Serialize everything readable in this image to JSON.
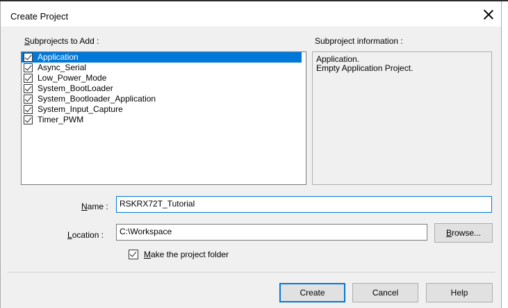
{
  "dialog": {
    "title": "Create Project",
    "close_glyph": "close-icon"
  },
  "subprojects": {
    "label_prefix": "",
    "label_u": "S",
    "label_rest": "ubprojects to Add :",
    "items": [
      {
        "label": "Application",
        "checked": true,
        "selected": true
      },
      {
        "label": "Async_Serial",
        "checked": true,
        "selected": false
      },
      {
        "label": "Low_Power_Mode",
        "checked": true,
        "selected": false
      },
      {
        "label": "System_BootLoader",
        "checked": true,
        "selected": false
      },
      {
        "label": "System_Bootloader_Application",
        "checked": true,
        "selected": false
      },
      {
        "label": "System_Input_Capture",
        "checked": true,
        "selected": false
      },
      {
        "label": "Timer_PWM",
        "checked": true,
        "selected": false
      }
    ]
  },
  "info": {
    "label": "Subproject information :",
    "lines": [
      "Application.",
      "Empty Application Project."
    ]
  },
  "name": {
    "label_u": "N",
    "label_rest": "ame :",
    "value": "RSKRX72T_Tutorial"
  },
  "location": {
    "label_u": "L",
    "label_rest": "ocation :",
    "value": "C:\\Workspace",
    "browse_u": "B",
    "browse_rest": "rowse..."
  },
  "make_folder": {
    "checked": true,
    "label_u": "M",
    "label_rest": "ake the project folder"
  },
  "buttons": {
    "create": "Create",
    "cancel": "Cancel",
    "help": "Help"
  }
}
